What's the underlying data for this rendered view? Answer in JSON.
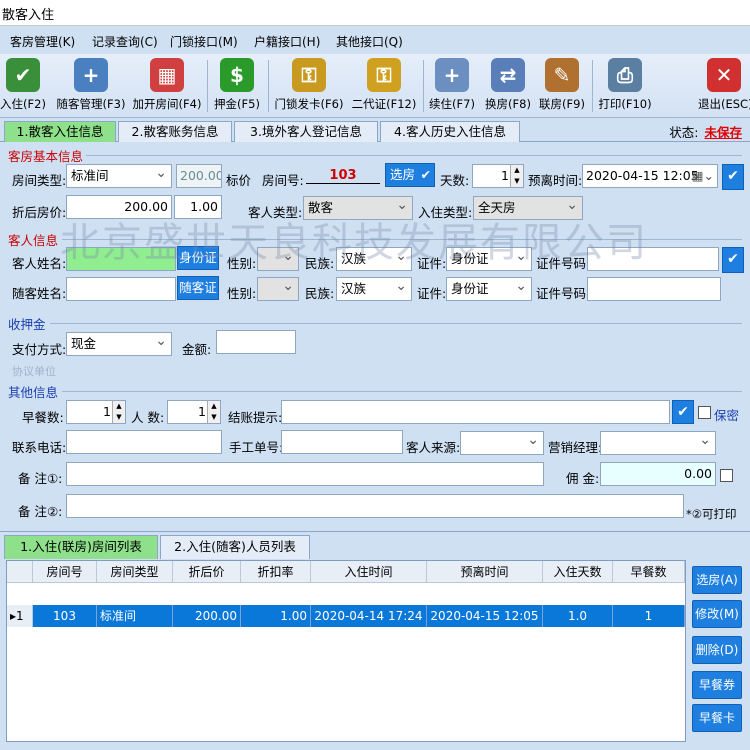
{
  "window": {
    "title": "散客入住"
  },
  "menu": [
    "客房管理(K)",
    "记录查询(C)",
    "门锁接口(M)",
    "户籍接口(H)",
    "其他接口(Q)"
  ],
  "toolbar": [
    {
      "label": "入住(F2)",
      "icon": "person-check-icon",
      "color": "#3a8f3a"
    },
    {
      "label": "随客管理(F3)",
      "icon": "add-person-icon",
      "color": "#4a7fc0"
    },
    {
      "label": "加开房间(F4)",
      "icon": "blocks-icon",
      "color": "#d04040"
    },
    {
      "label": "押金(F5)",
      "icon": "dollar-icon",
      "color": "#2a9a2a"
    },
    {
      "label": "门锁发卡(F6)",
      "icon": "key-card-icon",
      "color": "#c89a20"
    },
    {
      "label": "二代证(F12)",
      "icon": "id-card-key-icon",
      "color": "#d0a020"
    },
    {
      "label": "续住(F7)",
      "icon": "person-plus-icon",
      "color": "#6a8fc0"
    },
    {
      "label": "换房(F8)",
      "icon": "person-swap-icon",
      "color": "#5a7fb8"
    },
    {
      "label": "联房(F9)",
      "icon": "pen-link-icon",
      "color": "#b07030"
    },
    {
      "label": "打印(F10)",
      "icon": "printer-icon",
      "color": "#5a7fa0"
    },
    {
      "label": "退出(ESC)",
      "icon": "close-icon",
      "color": "#d03030"
    }
  ],
  "tabs": [
    "1.散客入住信息",
    "2.散客账务信息",
    "3.境外客人登记信息",
    "4.客人历史入住信息"
  ],
  "status": {
    "label": "状态:",
    "value": "未保存"
  },
  "room": {
    "section": "客房基本信息",
    "type_label": "房间类型:",
    "type_value": "标准间",
    "price": "200.00",
    "price_label": "标价",
    "room_no_label": "房间号:",
    "room_no": "103",
    "select_btn": "选房",
    "days_label": "天数:",
    "days": "1",
    "leave_label": "预离时间:",
    "leave_time": "2020-04-15 12:05",
    "discount_price_label": "折后房价:",
    "discount_price": "200.00",
    "discount_rate": "1.00",
    "guest_type_label": "客人类型:",
    "guest_type": "散客",
    "checkin_type_label": "入住类型:",
    "checkin_type": "全天房"
  },
  "guest": {
    "section": "客人信息",
    "name_label": "客人姓名:",
    "id_btn": "身份证",
    "gender_label": "性别:",
    "ethnic_label": "民族:",
    "ethnic": "汉族",
    "cert_label": "证件:",
    "cert": "身份证",
    "cert_no_label": "证件号码:",
    "companion_label": "随客姓名:",
    "companion_btn": "随客证",
    "gender2_label": "性别:",
    "ethnic2_label": "民族:",
    "ethnic2": "汉族",
    "cert2_label": "证件:",
    "cert2": "身份证",
    "cert_no2_label": "证件号码:"
  },
  "deposit": {
    "section": "收押金",
    "pay_label": "支付方式:",
    "pay": "现金",
    "amount_label": "金额:",
    "faded_label": "协议单位"
  },
  "other": {
    "section": "其他信息",
    "breakfast_label": "早餐数:",
    "breakfast": "1",
    "people_label": "人 数:",
    "people": "1",
    "checkout_tip_label": "结账提示:",
    "secret_label": "保密",
    "phone_label": "联系电话:",
    "manual_no_label": "手工单号:",
    "source_label": "客人来源:",
    "manager_label": "营销经理:",
    "note1_label": "备 注①:",
    "commission_label": "佣 金:",
    "commission": "0.00",
    "note2_label": "备 注②:",
    "print_hint": "*②可打印"
  },
  "watermark": "北京盛世天良科技发展有限公司",
  "bottom_tabs": [
    "1.入住(联房)房间列表",
    "2.入住(随客)人员列表"
  ],
  "grid": {
    "headers": [
      "房间号",
      "房间类型",
      "折后价",
      "折扣率",
      "入住时间",
      "预离时间",
      "入住天数",
      "早餐数"
    ],
    "rows": [
      {
        "marker": "▸1",
        "cells": [
          "103",
          "标准间",
          "200.00",
          "1.00",
          "2020-04-14 17:24",
          "2020-04-15 12:05",
          "1.0",
          "1"
        ]
      }
    ]
  },
  "side_buttons": [
    "选房(A)",
    "修改(M)",
    "删除(D)",
    "早餐券",
    "早餐卡"
  ]
}
